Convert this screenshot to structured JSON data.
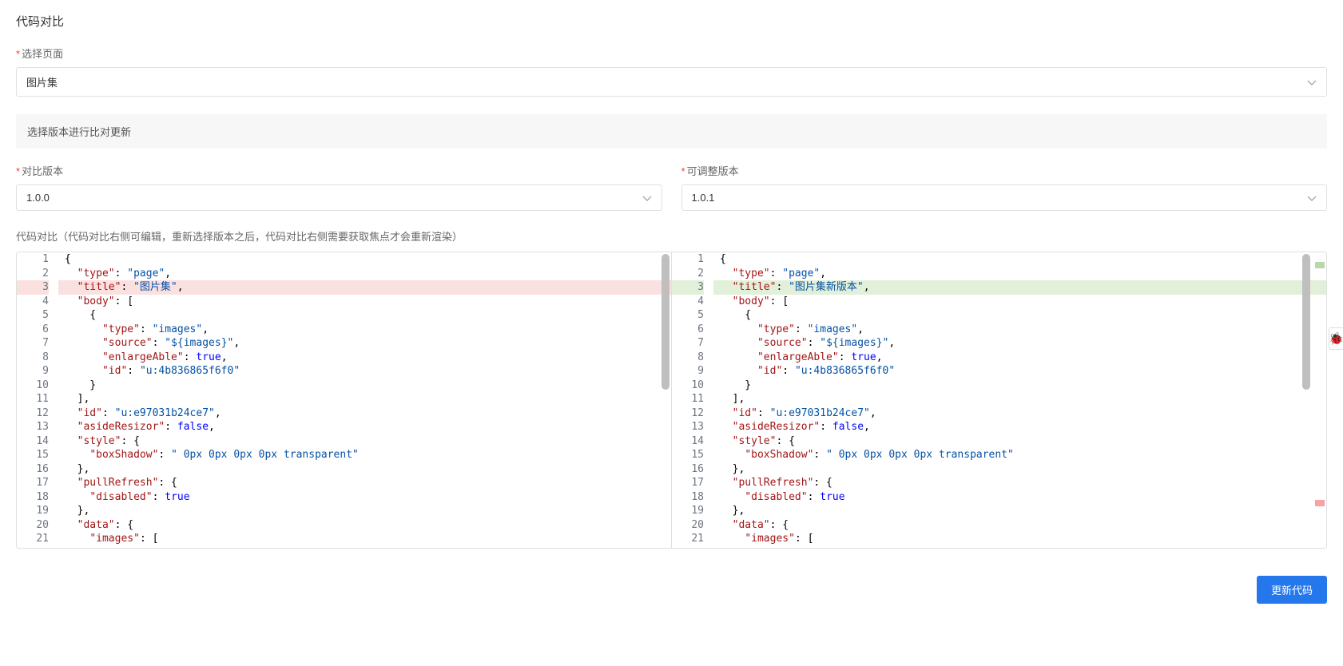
{
  "page_title": "代码对比",
  "select_page_label": "选择页面",
  "select_page_value": "图片集",
  "section_header": "选择版本进行比对更新",
  "compare_version_label": "对比版本",
  "compare_version_value": "1.0.0",
  "adjustable_version_label": "可调整版本",
  "adjustable_version_value": "1.0.1",
  "diff_note": "代码对比（代码对比右侧可编辑，重新选择版本之后，代码对比右侧需要获取焦点才会重新渲染）",
  "update_button": "更新代码",
  "left_lines": [
    {
      "n": "1",
      "marker": "",
      "cls": "",
      "tokens": [
        {
          "t": "{",
          "c": "punc"
        }
      ]
    },
    {
      "n": "2",
      "marker": "",
      "cls": "",
      "tokens": [
        {
          "t": "  ",
          "c": ""
        },
        {
          "t": "\"type\"",
          "c": "key"
        },
        {
          "t": ": ",
          "c": "punc"
        },
        {
          "t": "\"page\"",
          "c": "str"
        },
        {
          "t": ",",
          "c": "punc"
        }
      ]
    },
    {
      "n": "3",
      "marker": "−",
      "cls": "removed",
      "tokens": [
        {
          "t": "  ",
          "c": ""
        },
        {
          "t": "\"title\"",
          "c": "key"
        },
        {
          "t": ": ",
          "c": "punc"
        },
        {
          "t": "\"图片集\"",
          "c": "str"
        },
        {
          "t": ",",
          "c": "punc"
        }
      ]
    },
    {
      "n": "4",
      "marker": "",
      "cls": "",
      "tokens": [
        {
          "t": "  ",
          "c": ""
        },
        {
          "t": "\"body\"",
          "c": "key"
        },
        {
          "t": ": [",
          "c": "punc"
        }
      ]
    },
    {
      "n": "5",
      "marker": "",
      "cls": "",
      "tokens": [
        {
          "t": "    {",
          "c": "punc"
        }
      ]
    },
    {
      "n": "6",
      "marker": "",
      "cls": "",
      "tokens": [
        {
          "t": "      ",
          "c": ""
        },
        {
          "t": "\"type\"",
          "c": "key"
        },
        {
          "t": ": ",
          "c": "punc"
        },
        {
          "t": "\"images\"",
          "c": "str"
        },
        {
          "t": ",",
          "c": "punc"
        }
      ]
    },
    {
      "n": "7",
      "marker": "",
      "cls": "",
      "tokens": [
        {
          "t": "      ",
          "c": ""
        },
        {
          "t": "\"source\"",
          "c": "key"
        },
        {
          "t": ": ",
          "c": "punc"
        },
        {
          "t": "\"${images}\"",
          "c": "str"
        },
        {
          "t": ",",
          "c": "punc"
        }
      ]
    },
    {
      "n": "8",
      "marker": "",
      "cls": "",
      "tokens": [
        {
          "t": "      ",
          "c": ""
        },
        {
          "t": "\"enlargeAble\"",
          "c": "key"
        },
        {
          "t": ": ",
          "c": "punc"
        },
        {
          "t": "true",
          "c": "kw"
        },
        {
          "t": ",",
          "c": "punc"
        }
      ]
    },
    {
      "n": "9",
      "marker": "",
      "cls": "",
      "tokens": [
        {
          "t": "      ",
          "c": ""
        },
        {
          "t": "\"id\"",
          "c": "key"
        },
        {
          "t": ": ",
          "c": "punc"
        },
        {
          "t": "\"u:4b836865f6f0\"",
          "c": "str"
        }
      ]
    },
    {
      "n": "10",
      "marker": "",
      "cls": "",
      "tokens": [
        {
          "t": "    }",
          "c": "punc"
        }
      ]
    },
    {
      "n": "11",
      "marker": "",
      "cls": "",
      "tokens": [
        {
          "t": "  ],",
          "c": "punc"
        }
      ]
    },
    {
      "n": "12",
      "marker": "",
      "cls": "",
      "tokens": [
        {
          "t": "  ",
          "c": ""
        },
        {
          "t": "\"id\"",
          "c": "key"
        },
        {
          "t": ": ",
          "c": "punc"
        },
        {
          "t": "\"u:e97031b24ce7\"",
          "c": "str"
        },
        {
          "t": ",",
          "c": "punc"
        }
      ]
    },
    {
      "n": "13",
      "marker": "",
      "cls": "",
      "tokens": [
        {
          "t": "  ",
          "c": ""
        },
        {
          "t": "\"asideResizor\"",
          "c": "key"
        },
        {
          "t": ": ",
          "c": "punc"
        },
        {
          "t": "false",
          "c": "kw"
        },
        {
          "t": ",",
          "c": "punc"
        }
      ]
    },
    {
      "n": "14",
      "marker": "",
      "cls": "",
      "tokens": [
        {
          "t": "  ",
          "c": ""
        },
        {
          "t": "\"style\"",
          "c": "key"
        },
        {
          "t": ": {",
          "c": "punc"
        }
      ]
    },
    {
      "n": "15",
      "marker": "",
      "cls": "",
      "tokens": [
        {
          "t": "    ",
          "c": ""
        },
        {
          "t": "\"boxShadow\"",
          "c": "key"
        },
        {
          "t": ": ",
          "c": "punc"
        },
        {
          "t": "\" 0px 0px 0px 0px transparent\"",
          "c": "str"
        }
      ]
    },
    {
      "n": "16",
      "marker": "",
      "cls": "",
      "tokens": [
        {
          "t": "  },",
          "c": "punc"
        }
      ]
    },
    {
      "n": "17",
      "marker": "",
      "cls": "",
      "tokens": [
        {
          "t": "  ",
          "c": ""
        },
        {
          "t": "\"pullRefresh\"",
          "c": "key"
        },
        {
          "t": ": {",
          "c": "punc"
        }
      ]
    },
    {
      "n": "18",
      "marker": "",
      "cls": "",
      "tokens": [
        {
          "t": "    ",
          "c": ""
        },
        {
          "t": "\"disabled\"",
          "c": "key"
        },
        {
          "t": ": ",
          "c": "punc"
        },
        {
          "t": "true",
          "c": "kw"
        }
      ]
    },
    {
      "n": "19",
      "marker": "",
      "cls": "",
      "tokens": [
        {
          "t": "  },",
          "c": "punc"
        }
      ]
    },
    {
      "n": "20",
      "marker": "",
      "cls": "",
      "tokens": [
        {
          "t": "  ",
          "c": ""
        },
        {
          "t": "\"data\"",
          "c": "key"
        },
        {
          "t": ": {",
          "c": "punc"
        }
      ]
    },
    {
      "n": "21",
      "marker": "",
      "cls": "",
      "tokens": [
        {
          "t": "    ",
          "c": ""
        },
        {
          "t": "\"images\"",
          "c": "key"
        },
        {
          "t": ": [",
          "c": "punc"
        }
      ]
    }
  ],
  "right_lines": [
    {
      "n": "1",
      "marker": "",
      "cls": "",
      "tokens": [
        {
          "t": "{",
          "c": "punc"
        }
      ]
    },
    {
      "n": "2",
      "marker": "",
      "cls": "",
      "tokens": [
        {
          "t": "  ",
          "c": ""
        },
        {
          "t": "\"type\"",
          "c": "key"
        },
        {
          "t": ": ",
          "c": "punc"
        },
        {
          "t": "\"page\"",
          "c": "str"
        },
        {
          "t": ",",
          "c": "punc"
        }
      ]
    },
    {
      "n": "3",
      "marker": "+",
      "cls": "added",
      "tokens": [
        {
          "t": "  ",
          "c": ""
        },
        {
          "t": "\"title\"",
          "c": "key"
        },
        {
          "t": ": ",
          "c": "punc"
        },
        {
          "t": "\"图片集新版本\"",
          "c": "str"
        },
        {
          "t": ",",
          "c": "punc"
        }
      ]
    },
    {
      "n": "4",
      "marker": "",
      "cls": "",
      "tokens": [
        {
          "t": "  ",
          "c": ""
        },
        {
          "t": "\"body\"",
          "c": "key"
        },
        {
          "t": ": [",
          "c": "punc"
        }
      ]
    },
    {
      "n": "5",
      "marker": "",
      "cls": "",
      "tokens": [
        {
          "t": "    {",
          "c": "punc"
        }
      ]
    },
    {
      "n": "6",
      "marker": "",
      "cls": "",
      "tokens": [
        {
          "t": "      ",
          "c": ""
        },
        {
          "t": "\"type\"",
          "c": "key"
        },
        {
          "t": ": ",
          "c": "punc"
        },
        {
          "t": "\"images\"",
          "c": "str"
        },
        {
          "t": ",",
          "c": "punc"
        }
      ]
    },
    {
      "n": "7",
      "marker": "",
      "cls": "",
      "tokens": [
        {
          "t": "      ",
          "c": ""
        },
        {
          "t": "\"source\"",
          "c": "key"
        },
        {
          "t": ": ",
          "c": "punc"
        },
        {
          "t": "\"${images}\"",
          "c": "str"
        },
        {
          "t": ",",
          "c": "punc"
        }
      ]
    },
    {
      "n": "8",
      "marker": "",
      "cls": "",
      "tokens": [
        {
          "t": "      ",
          "c": ""
        },
        {
          "t": "\"enlargeAble\"",
          "c": "key"
        },
        {
          "t": ": ",
          "c": "punc"
        },
        {
          "t": "true",
          "c": "kw"
        },
        {
          "t": ",",
          "c": "punc"
        }
      ]
    },
    {
      "n": "9",
      "marker": "",
      "cls": "",
      "tokens": [
        {
          "t": "      ",
          "c": ""
        },
        {
          "t": "\"id\"",
          "c": "key"
        },
        {
          "t": ": ",
          "c": "punc"
        },
        {
          "t": "\"u:4b836865f6f0\"",
          "c": "str"
        }
      ]
    },
    {
      "n": "10",
      "marker": "",
      "cls": "",
      "tokens": [
        {
          "t": "    }",
          "c": "punc"
        }
      ]
    },
    {
      "n": "11",
      "marker": "",
      "cls": "",
      "tokens": [
        {
          "t": "  ],",
          "c": "punc"
        }
      ]
    },
    {
      "n": "12",
      "marker": "",
      "cls": "",
      "tokens": [
        {
          "t": "  ",
          "c": ""
        },
        {
          "t": "\"id\"",
          "c": "key"
        },
        {
          "t": ": ",
          "c": "punc"
        },
        {
          "t": "\"u:e97031b24ce7\"",
          "c": "str"
        },
        {
          "t": ",",
          "c": "punc"
        }
      ]
    },
    {
      "n": "13",
      "marker": "",
      "cls": "",
      "tokens": [
        {
          "t": "  ",
          "c": ""
        },
        {
          "t": "\"asideResizor\"",
          "c": "key"
        },
        {
          "t": ": ",
          "c": "punc"
        },
        {
          "t": "false",
          "c": "kw"
        },
        {
          "t": ",",
          "c": "punc"
        }
      ]
    },
    {
      "n": "14",
      "marker": "",
      "cls": "",
      "tokens": [
        {
          "t": "  ",
          "c": ""
        },
        {
          "t": "\"style\"",
          "c": "key"
        },
        {
          "t": ": {",
          "c": "punc"
        }
      ]
    },
    {
      "n": "15",
      "marker": "",
      "cls": "",
      "tokens": [
        {
          "t": "    ",
          "c": ""
        },
        {
          "t": "\"boxShadow\"",
          "c": "key"
        },
        {
          "t": ": ",
          "c": "punc"
        },
        {
          "t": "\" 0px 0px 0px 0px transparent\"",
          "c": "str"
        }
      ]
    },
    {
      "n": "16",
      "marker": "",
      "cls": "",
      "tokens": [
        {
          "t": "  },",
          "c": "punc"
        }
      ]
    },
    {
      "n": "17",
      "marker": "",
      "cls": "",
      "tokens": [
        {
          "t": "  ",
          "c": ""
        },
        {
          "t": "\"pullRefresh\"",
          "c": "key"
        },
        {
          "t": ": {",
          "c": "punc"
        }
      ]
    },
    {
      "n": "18",
      "marker": "",
      "cls": "",
      "tokens": [
        {
          "t": "    ",
          "c": ""
        },
        {
          "t": "\"disabled\"",
          "c": "key"
        },
        {
          "t": ": ",
          "c": "punc"
        },
        {
          "t": "true",
          "c": "kw"
        }
      ]
    },
    {
      "n": "19",
      "marker": "",
      "cls": "",
      "tokens": [
        {
          "t": "  },",
          "c": "punc"
        }
      ]
    },
    {
      "n": "20",
      "marker": "",
      "cls": "",
      "tokens": [
        {
          "t": "  ",
          "c": ""
        },
        {
          "t": "\"data\"",
          "c": "key"
        },
        {
          "t": ": {",
          "c": "punc"
        }
      ]
    },
    {
      "n": "21",
      "marker": "",
      "cls": "",
      "tokens": [
        {
          "t": "    ",
          "c": ""
        },
        {
          "t": "\"images\"",
          "c": "key"
        },
        {
          "t": ": [",
          "c": "punc"
        }
      ]
    }
  ]
}
